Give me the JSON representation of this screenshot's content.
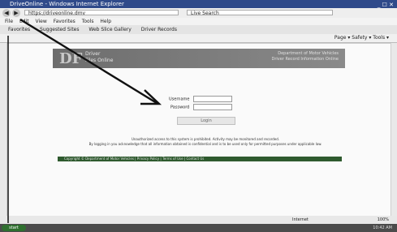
{
  "titlebar": {
    "title": "DriveOnline - Windows Internet Explorer",
    "buttons": "_ ☐ ✕"
  },
  "addressbar": {
    "back": "◀",
    "forward": "▶",
    "url": "https://driveonline.dmv",
    "search": "Live Search"
  },
  "menubar": {
    "items": [
      "File",
      "Edit",
      "View",
      "Favorites",
      "Tools",
      "Help"
    ]
  },
  "favbar": {
    "items": [
      "Favorites",
      "Suggested Sites",
      "Web Slice Gallery",
      "Driver Records"
    ]
  },
  "cmdbar": {
    "tools": "Page ▾   Safety ▾   Tools ▾"
  },
  "site": {
    "logo": "DF",
    "name_line1": "Driver",
    "name_line2": "Files Online",
    "header_right_1": "Department of Motor Vehicles",
    "header_right_2": "Driver Record Information Online"
  },
  "login": {
    "username_label": "Username",
    "password_label": "Password",
    "button": "Login"
  },
  "notice": {
    "line1": "Unauthorized access to this system is prohibited. Activity may be monitored and recorded.",
    "line2": "By logging in you acknowledge that all information obtained is confidential and is to be used only for permitted purposes under applicable law."
  },
  "footer": {
    "text": "Copyright © Department of Motor Vehicles  |  Privacy Policy  |  Terms of Use  |  Contact Us"
  },
  "statusbar": {
    "zone": "Internet",
    "zoom": "100%"
  },
  "taskbar": {
    "start": "start",
    "clock": "10:42 AM"
  }
}
